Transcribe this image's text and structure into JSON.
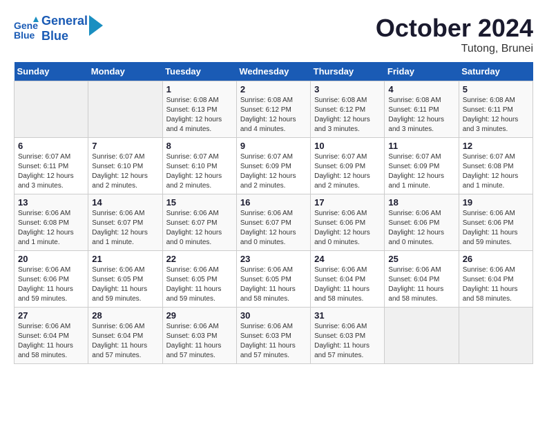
{
  "header": {
    "logo_line1": "General",
    "logo_line2": "Blue",
    "month_title": "October 2024",
    "subtitle": "Tutong, Brunei"
  },
  "days_of_week": [
    "Sunday",
    "Monday",
    "Tuesday",
    "Wednesday",
    "Thursday",
    "Friday",
    "Saturday"
  ],
  "weeks": [
    [
      {
        "day": "",
        "info": ""
      },
      {
        "day": "",
        "info": ""
      },
      {
        "day": "1",
        "info": "Sunrise: 6:08 AM\nSunset: 6:13 PM\nDaylight: 12 hours and 4 minutes."
      },
      {
        "day": "2",
        "info": "Sunrise: 6:08 AM\nSunset: 6:12 PM\nDaylight: 12 hours and 4 minutes."
      },
      {
        "day": "3",
        "info": "Sunrise: 6:08 AM\nSunset: 6:12 PM\nDaylight: 12 hours and 3 minutes."
      },
      {
        "day": "4",
        "info": "Sunrise: 6:08 AM\nSunset: 6:11 PM\nDaylight: 12 hours and 3 minutes."
      },
      {
        "day": "5",
        "info": "Sunrise: 6:08 AM\nSunset: 6:11 PM\nDaylight: 12 hours and 3 minutes."
      }
    ],
    [
      {
        "day": "6",
        "info": "Sunrise: 6:07 AM\nSunset: 6:11 PM\nDaylight: 12 hours and 3 minutes."
      },
      {
        "day": "7",
        "info": "Sunrise: 6:07 AM\nSunset: 6:10 PM\nDaylight: 12 hours and 2 minutes."
      },
      {
        "day": "8",
        "info": "Sunrise: 6:07 AM\nSunset: 6:10 PM\nDaylight: 12 hours and 2 minutes."
      },
      {
        "day": "9",
        "info": "Sunrise: 6:07 AM\nSunset: 6:09 PM\nDaylight: 12 hours and 2 minutes."
      },
      {
        "day": "10",
        "info": "Sunrise: 6:07 AM\nSunset: 6:09 PM\nDaylight: 12 hours and 2 minutes."
      },
      {
        "day": "11",
        "info": "Sunrise: 6:07 AM\nSunset: 6:09 PM\nDaylight: 12 hours and 1 minute."
      },
      {
        "day": "12",
        "info": "Sunrise: 6:07 AM\nSunset: 6:08 PM\nDaylight: 12 hours and 1 minute."
      }
    ],
    [
      {
        "day": "13",
        "info": "Sunrise: 6:06 AM\nSunset: 6:08 PM\nDaylight: 12 hours and 1 minute."
      },
      {
        "day": "14",
        "info": "Sunrise: 6:06 AM\nSunset: 6:07 PM\nDaylight: 12 hours and 1 minute."
      },
      {
        "day": "15",
        "info": "Sunrise: 6:06 AM\nSunset: 6:07 PM\nDaylight: 12 hours and 0 minutes."
      },
      {
        "day": "16",
        "info": "Sunrise: 6:06 AM\nSunset: 6:07 PM\nDaylight: 12 hours and 0 minutes."
      },
      {
        "day": "17",
        "info": "Sunrise: 6:06 AM\nSunset: 6:06 PM\nDaylight: 12 hours and 0 minutes."
      },
      {
        "day": "18",
        "info": "Sunrise: 6:06 AM\nSunset: 6:06 PM\nDaylight: 12 hours and 0 minutes."
      },
      {
        "day": "19",
        "info": "Sunrise: 6:06 AM\nSunset: 6:06 PM\nDaylight: 11 hours and 59 minutes."
      }
    ],
    [
      {
        "day": "20",
        "info": "Sunrise: 6:06 AM\nSunset: 6:06 PM\nDaylight: 11 hours and 59 minutes."
      },
      {
        "day": "21",
        "info": "Sunrise: 6:06 AM\nSunset: 6:05 PM\nDaylight: 11 hours and 59 minutes."
      },
      {
        "day": "22",
        "info": "Sunrise: 6:06 AM\nSunset: 6:05 PM\nDaylight: 11 hours and 59 minutes."
      },
      {
        "day": "23",
        "info": "Sunrise: 6:06 AM\nSunset: 6:05 PM\nDaylight: 11 hours and 58 minutes."
      },
      {
        "day": "24",
        "info": "Sunrise: 6:06 AM\nSunset: 6:04 PM\nDaylight: 11 hours and 58 minutes."
      },
      {
        "day": "25",
        "info": "Sunrise: 6:06 AM\nSunset: 6:04 PM\nDaylight: 11 hours and 58 minutes."
      },
      {
        "day": "26",
        "info": "Sunrise: 6:06 AM\nSunset: 6:04 PM\nDaylight: 11 hours and 58 minutes."
      }
    ],
    [
      {
        "day": "27",
        "info": "Sunrise: 6:06 AM\nSunset: 6:04 PM\nDaylight: 11 hours and 58 minutes."
      },
      {
        "day": "28",
        "info": "Sunrise: 6:06 AM\nSunset: 6:04 PM\nDaylight: 11 hours and 57 minutes."
      },
      {
        "day": "29",
        "info": "Sunrise: 6:06 AM\nSunset: 6:03 PM\nDaylight: 11 hours and 57 minutes."
      },
      {
        "day": "30",
        "info": "Sunrise: 6:06 AM\nSunset: 6:03 PM\nDaylight: 11 hours and 57 minutes."
      },
      {
        "day": "31",
        "info": "Sunrise: 6:06 AM\nSunset: 6:03 PM\nDaylight: 11 hours and 57 minutes."
      },
      {
        "day": "",
        "info": ""
      },
      {
        "day": "",
        "info": ""
      }
    ]
  ]
}
